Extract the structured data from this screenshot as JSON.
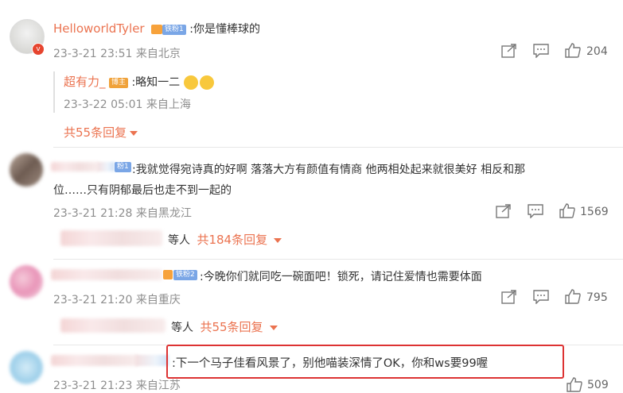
{
  "comments": [
    {
      "username": "HelloworldTyler",
      "badge": "铁粉1",
      "text": ":你是懂棒球的",
      "time": "23-3-21 23:51 来自北京",
      "likes": "204",
      "reply": {
        "username": "超有力_",
        "badge": "博主",
        "text": ":略知一二",
        "time": "23-3-22 05:01 来自上海"
      },
      "more_replies": "共55条回复"
    },
    {
      "badge": "粉1",
      "text_line1": ":我就觉得宛诗真的好啊 落落大方有颜值有情商   他两相处起来就很美好  相反和那",
      "text_line2": "位……只有阴郁最后也走不到一起的",
      "time": "23-3-21 21:28 来自黑龙江",
      "likes": "1569",
      "replies_prefix": "等人",
      "replies_count": "共184条回复"
    },
    {
      "badge": "铁粉2",
      "text": ":今晚你们就同吃一碗面吧！锁死，请记住爱情也需要体面",
      "time": "23-3-21 21:20 来自重庆",
      "likes": "795",
      "replies_prefix": "等人",
      "replies_count": "共55条回复"
    },
    {
      "text": ":下一个马子佳看风景了，别他喵装深情了OK，你和ws要99喔",
      "time": "23-3-21 21:23 来自江苏",
      "likes": "509"
    }
  ],
  "colors": {
    "accent": "#eb7350",
    "highlight": "#d33333"
  }
}
